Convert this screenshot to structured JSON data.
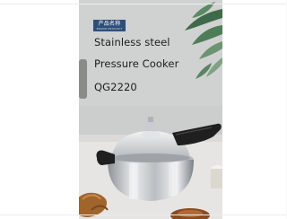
{
  "product": {
    "brand_badge": "产品名称",
    "brand_badge_sub": "BRAND PRODUCT",
    "line1": "Stainless steel",
    "line2": "Pressure Cooker",
    "line3": "QG2220"
  },
  "colors": {
    "badge": "#2e4f7a",
    "handle": "#1f1f1f",
    "steel": "#c8ccd0",
    "leaf": "#3f6a4a"
  }
}
